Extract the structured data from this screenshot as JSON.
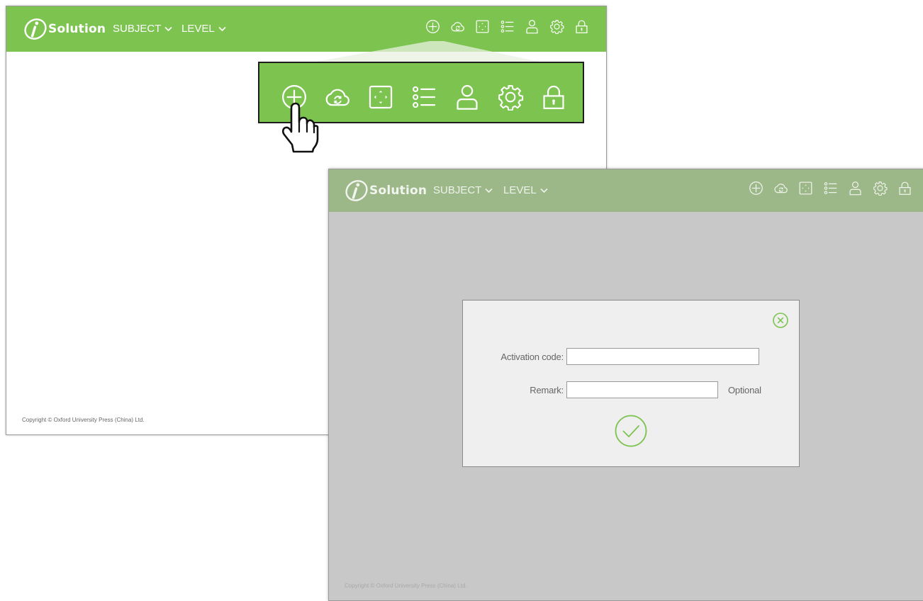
{
  "app": {
    "logo_text": "Solution",
    "nav": {
      "subject_label": "SUBJECT",
      "level_label": "LEVEL"
    },
    "toolbar_icons": [
      "add-icon",
      "cloud-sync-icon",
      "fullscreen-icon",
      "list-icon",
      "user-icon",
      "settings-icon",
      "lock-icon"
    ],
    "copyright": "Copyright © Oxford University Press (China) Ltd."
  },
  "activation_dialog": {
    "activation_code_label": "Activation code:",
    "activation_code_value": "",
    "remark_label": "Remark:",
    "remark_value": "",
    "remark_hint": "Optional"
  },
  "colors": {
    "brand_green": "#7cc350",
    "dimmed_green": "#9cb889",
    "overlay_gray": "#c8c8c8",
    "toolbar_border": "#1e1e1e"
  }
}
